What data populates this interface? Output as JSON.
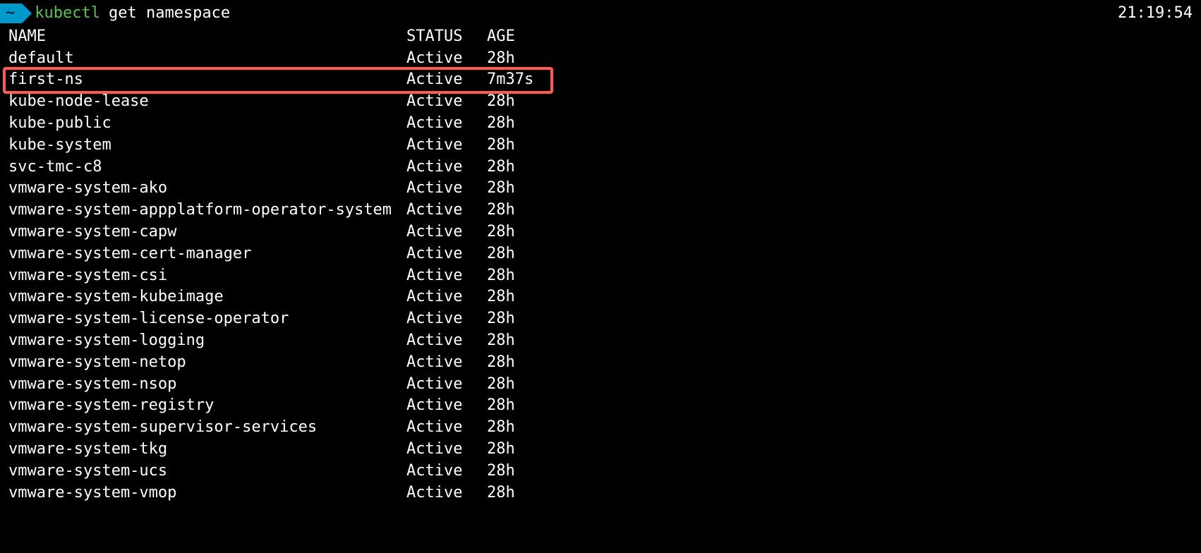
{
  "prompt": {
    "badge": "~",
    "command_name": "kubectl",
    "command_args": "get namespace"
  },
  "clock": "21:19:54",
  "headers": {
    "name": "NAME",
    "status": "STATUS",
    "age": "AGE"
  },
  "rows": [
    {
      "name": "default",
      "status": "Active",
      "age": "28h",
      "highlight": false
    },
    {
      "name": "first-ns",
      "status": "Active",
      "age": "7m37s",
      "highlight": true
    },
    {
      "name": "kube-node-lease",
      "status": "Active",
      "age": "28h",
      "highlight": false
    },
    {
      "name": "kube-public",
      "status": "Active",
      "age": "28h",
      "highlight": false
    },
    {
      "name": "kube-system",
      "status": "Active",
      "age": "28h",
      "highlight": false
    },
    {
      "name": "svc-tmc-c8",
      "status": "Active",
      "age": "28h",
      "highlight": false
    },
    {
      "name": "vmware-system-ako",
      "status": "Active",
      "age": "28h",
      "highlight": false
    },
    {
      "name": "vmware-system-appplatform-operator-system",
      "status": "Active",
      "age": "28h",
      "highlight": false
    },
    {
      "name": "vmware-system-capw",
      "status": "Active",
      "age": "28h",
      "highlight": false
    },
    {
      "name": "vmware-system-cert-manager",
      "status": "Active",
      "age": "28h",
      "highlight": false
    },
    {
      "name": "vmware-system-csi",
      "status": "Active",
      "age": "28h",
      "highlight": false
    },
    {
      "name": "vmware-system-kubeimage",
      "status": "Active",
      "age": "28h",
      "highlight": false
    },
    {
      "name": "vmware-system-license-operator",
      "status": "Active",
      "age": "28h",
      "highlight": false
    },
    {
      "name": "vmware-system-logging",
      "status": "Active",
      "age": "28h",
      "highlight": false
    },
    {
      "name": "vmware-system-netop",
      "status": "Active",
      "age": "28h",
      "highlight": false
    },
    {
      "name": "vmware-system-nsop",
      "status": "Active",
      "age": "28h",
      "highlight": false
    },
    {
      "name": "vmware-system-registry",
      "status": "Active",
      "age": "28h",
      "highlight": false
    },
    {
      "name": "vmware-system-supervisor-services",
      "status": "Active",
      "age": "28h",
      "highlight": false
    },
    {
      "name": "vmware-system-tkg",
      "status": "Active",
      "age": "28h",
      "highlight": false
    },
    {
      "name": "vmware-system-ucs",
      "status": "Active",
      "age": "28h",
      "highlight": false
    },
    {
      "name": "vmware-system-vmop",
      "status": "Active",
      "age": "28h",
      "highlight": false
    }
  ],
  "colors": {
    "highlight_border": "#ff5a4d",
    "prompt_bg": "#0099cc",
    "command_color": "#4ec94e"
  }
}
